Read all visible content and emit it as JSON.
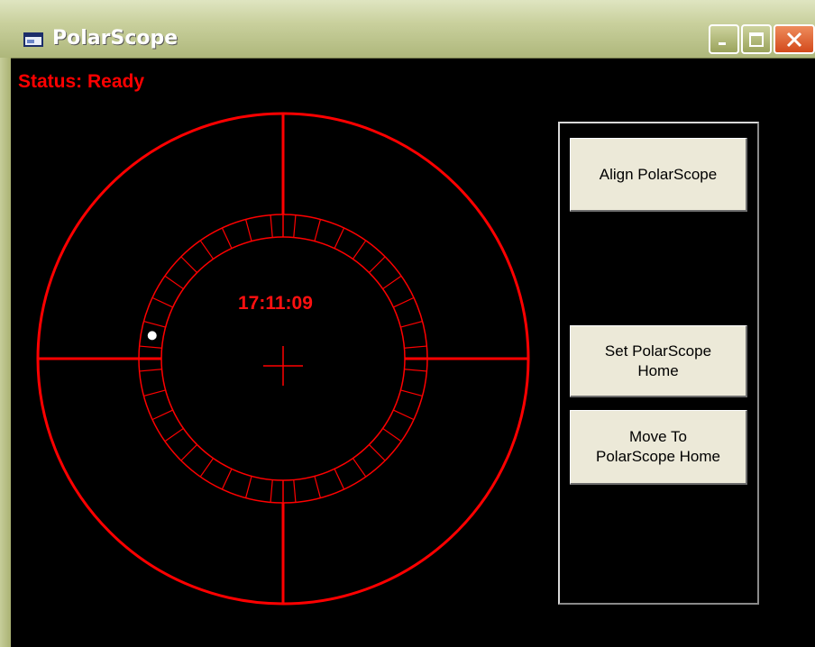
{
  "window": {
    "title": "PolarScope",
    "controls": [
      "minimize",
      "maximize",
      "close"
    ]
  },
  "status": {
    "text": "Status: Ready"
  },
  "scope": {
    "time": "17:11:09",
    "marker_angle_deg": 170,
    "ring_segments": 36,
    "color": "#ff0000"
  },
  "buttons": {
    "align": "Align PolarScope",
    "set_home_line1": "Set PolarScope",
    "set_home_line2": "Home",
    "move_line1": "Move To",
    "move_line2": "PolarScope Home"
  }
}
